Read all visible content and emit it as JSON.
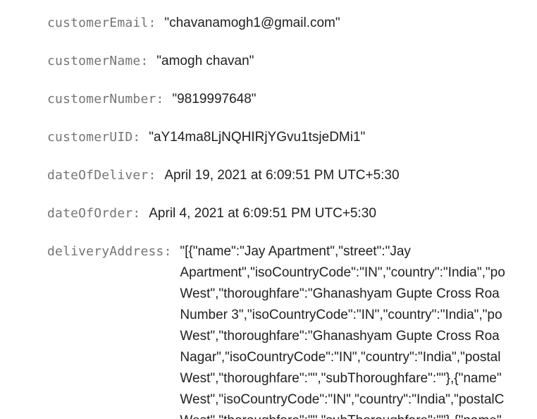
{
  "fields": [
    {
      "key": "customerEmail",
      "value": "\"chavanamogh1@gmail.com\""
    },
    {
      "key": "customerName",
      "value": "\"amogh chavan\""
    },
    {
      "key": "customerNumber",
      "value": "\"9819997648\""
    },
    {
      "key": "customerUID",
      "value": "\"aY14ma8LjNQHIRjYGvu1tsjeDMi1\""
    },
    {
      "key": "dateOfDeliver",
      "value": "April 19, 2021 at 6:09:51 PM UTC+5:30"
    },
    {
      "key": "dateOfOrder",
      "value": "April 4, 2021 at 6:09:51 PM UTC+5:30"
    }
  ],
  "deliveryAddress": {
    "key": "deliveryAddress",
    "lines": [
      "\"[{\"name\":\"Jay Apartment\",\"street\":\"Jay",
      "Apartment\",\"isoCountryCode\":\"IN\",\"country\":\"India\",\"po",
      "West\",\"thoroughfare\":\"Ghanashyam Gupte Cross Roa",
      "Number 3\",\"isoCountryCode\":\"IN\",\"country\":\"India\",\"po",
      "West\",\"thoroughfare\":\"Ghanashyam Gupte Cross Roa",
      "Nagar\",\"isoCountryCode\":\"IN\",\"country\":\"India\",\"postal",
      "West\",\"thoroughfare\":\"\",\"subThoroughfare\":\"\"},{\"name\"",
      "West\",\"isoCountryCode\":\"IN\",\"country\":\"India\",\"postalC",
      "West\",\"thoroughfare\":\"\",\"subThoroughfare\":\"\"},{\"name\""
    ]
  }
}
